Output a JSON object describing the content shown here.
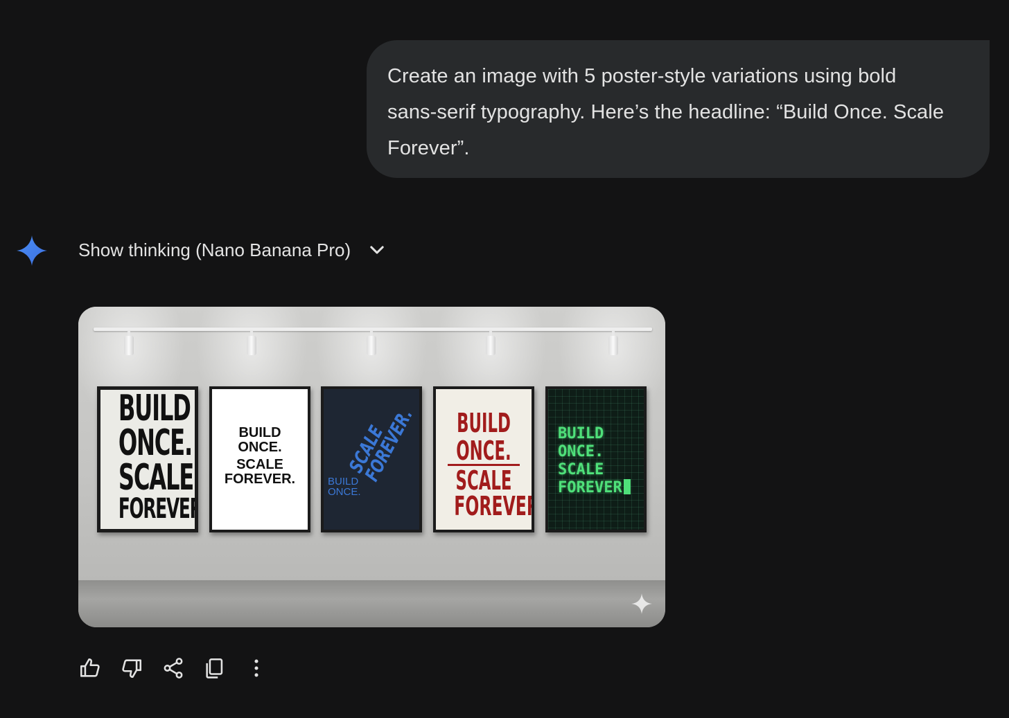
{
  "user_prompt": {
    "line1": "Create an image with 5 poster-style variations using bold",
    "line2": "sans-serif typography. Here’s the headline: “Build Once. Scale",
    "line3": "Forever”."
  },
  "response": {
    "thinking_label": "Show thinking (Nano Banana Pro)",
    "icons": {
      "assistant": "gemini-sparkle-icon",
      "toggle": "chevron-down-icon",
      "image_badge": "sparkle-icon"
    },
    "accent_color": "#4b8ff5"
  },
  "posters": {
    "p1": {
      "l1": "BUILD",
      "l2": "ONCE.",
      "l3": "SCALE",
      "l4": "FOREVER."
    },
    "p2": {
      "l1": "BUILD",
      "l2": "ONCE.",
      "l3": "SCALE",
      "l4": "FOREVER."
    },
    "p3": {
      "small1": "BUILD",
      "small2": "ONCE.",
      "big1": "SCALE",
      "big2": "FOREVER."
    },
    "p4": {
      "l1": "BUILD",
      "l2": "ONCE.",
      "l3": "SCALE",
      "l4": "FOREVER."
    },
    "p5": {
      "l1": "BUILD",
      "l2": "ONCE.",
      "l3": "SCALE",
      "l4": "FOREVER"
    }
  },
  "actions": [
    {
      "icon": "thumbs-up-icon"
    },
    {
      "icon": "thumbs-down-icon"
    },
    {
      "icon": "share-icon"
    },
    {
      "icon": "copy-icon"
    },
    {
      "icon": "more-vertical-icon"
    }
  ]
}
